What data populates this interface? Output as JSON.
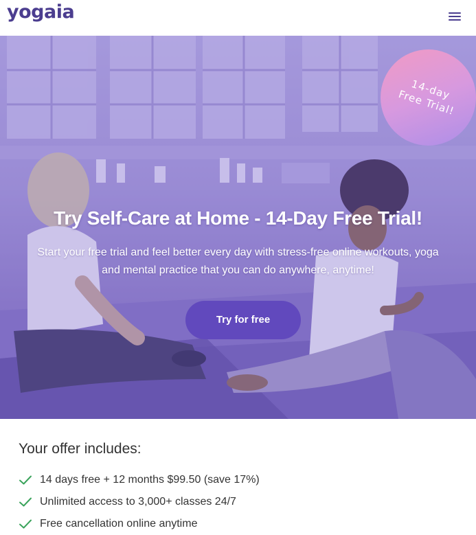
{
  "header": {
    "logo": "yogaia",
    "menu_icon": "hamburger-menu-icon"
  },
  "hero": {
    "badge_line1": "14-day",
    "badge_line2": "Free Trial!",
    "title": "Try Self-Care at Home - 14-Day Free Trial!",
    "subtitle_line1": "Start your free trial and feel better every day with stress-free online workouts, yoga",
    "subtitle_line2": "and mental practice that you can do anywhere, anytime!",
    "cta_label": "Try for free"
  },
  "offer": {
    "title": "Your offer includes:",
    "items": [
      {
        "text": "14 days free + 12 months $99.50 (save 17%)",
        "icon": "check-icon"
      },
      {
        "text": "Unlimited access to 3,000+ classes 24/7",
        "icon": "check-icon"
      },
      {
        "text": "Free cancellation online anytime",
        "icon": "check-icon"
      }
    ]
  },
  "colors": {
    "brand": "#4b3d8f",
    "cta": "#6149bd",
    "check": "#3aa35b",
    "badge_start": "#f19bc4",
    "badge_end": "#ad8ee8"
  }
}
